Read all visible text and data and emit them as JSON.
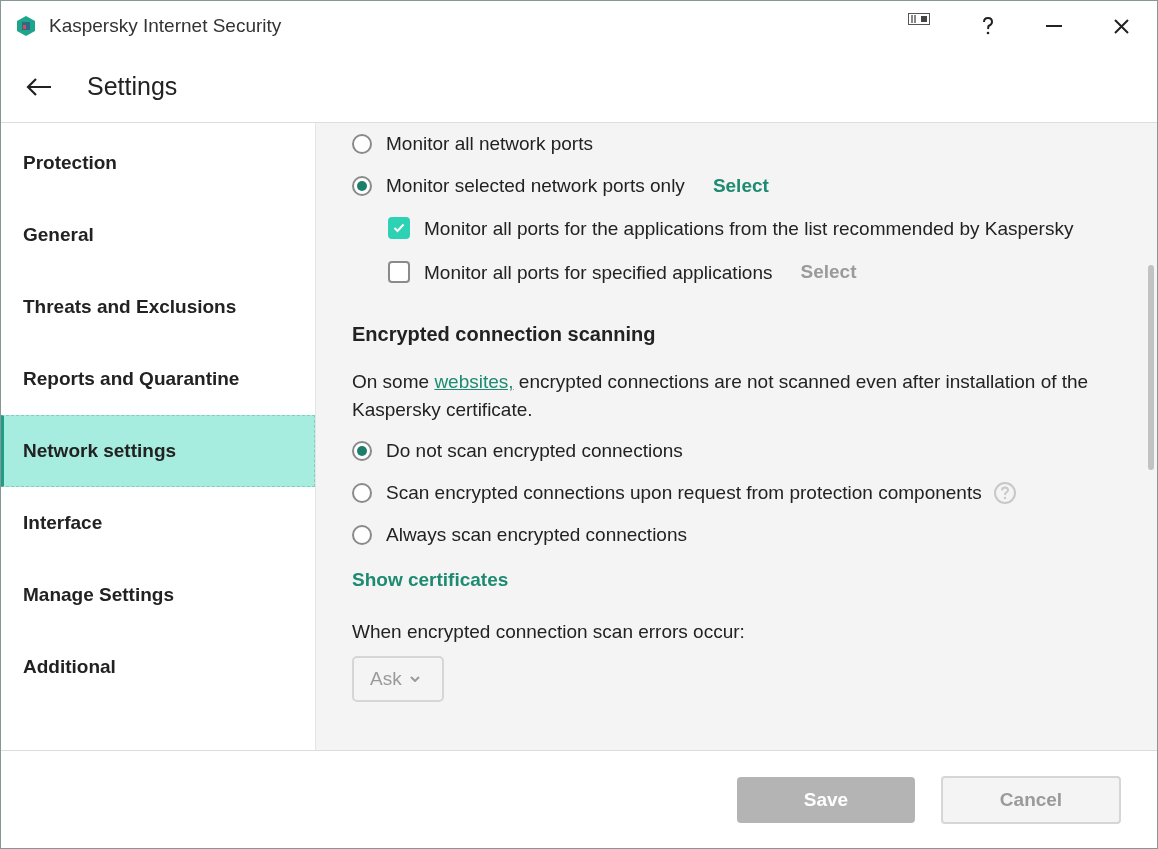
{
  "window": {
    "title": "Kaspersky Internet Security"
  },
  "header": {
    "title": "Settings"
  },
  "sidebar": {
    "items": [
      {
        "label": "Protection",
        "selected": false
      },
      {
        "label": "General",
        "selected": false
      },
      {
        "label": "Threats and Exclusions",
        "selected": false
      },
      {
        "label": "Reports and Quarantine",
        "selected": false
      },
      {
        "label": "Network settings",
        "selected": true
      },
      {
        "label": "Interface",
        "selected": false
      },
      {
        "label": "Manage Settings",
        "selected": false
      },
      {
        "label": "Additional",
        "selected": false
      }
    ]
  },
  "ports": {
    "options": [
      {
        "label": "Monitor all network ports",
        "selected": false
      },
      {
        "label": "Monitor selected network ports only",
        "selected": true,
        "link": {
          "label": "Select",
          "disabled": false
        }
      }
    ],
    "sub_options": [
      {
        "label": "Monitor all ports for the applications from the list recommended by Kaspersky",
        "checked": true
      },
      {
        "label": "Monitor all ports for specified applications",
        "checked": false,
        "link": {
          "label": "Select",
          "disabled": true
        }
      }
    ]
  },
  "encrypted": {
    "heading": "Encrypted connection scanning",
    "description": {
      "before": "On some ",
      "link": "websites,",
      "after": " encrypted connections are not scanned even after installation of the Kaspersky certificate."
    },
    "options": [
      {
        "label": "Do not scan encrypted connections",
        "selected": true,
        "help": false
      },
      {
        "label": "Scan encrypted connections upon request from protection components",
        "selected": false,
        "help": true
      },
      {
        "label": "Always scan encrypted connections",
        "selected": false,
        "help": false
      }
    ],
    "show_certificates": "Show certificates",
    "errors_label": "When encrypted connection scan errors occur:",
    "errors_dropdown": {
      "value": "Ask",
      "disabled": true
    }
  },
  "footer": {
    "buttons": [
      {
        "label": "Save",
        "kind": "primary",
        "disabled": true
      },
      {
        "label": "Cancel",
        "kind": "secondary",
        "disabled": true
      }
    ]
  }
}
